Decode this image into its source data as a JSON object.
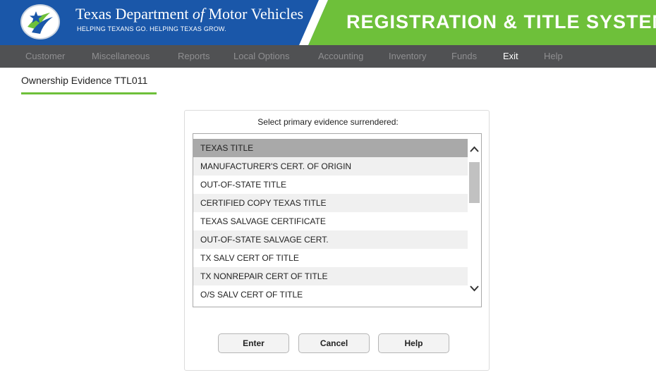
{
  "header": {
    "agency_name_part1": "Texas Department ",
    "agency_name_of": "of",
    "agency_name_part2": " Motor Vehicles",
    "tagline": "HELPING TEXANS GO. HELPING TEXAS GROW.",
    "system_title": "REGISTRATION & TITLE SYSTEM",
    "colors": {
      "blue": "#1a57a9",
      "green": "#6ec03a"
    }
  },
  "nav": {
    "items": [
      {
        "label": "Customer",
        "active": false
      },
      {
        "label": "Miscellaneous",
        "active": false
      },
      {
        "label": "Reports",
        "active": false
      },
      {
        "label": "Local Options",
        "active": false
      },
      {
        "label": "Accounting",
        "active": false
      },
      {
        "label": "Inventory",
        "active": false
      },
      {
        "label": "Funds",
        "active": false
      },
      {
        "label": "Exit",
        "active": true
      },
      {
        "label": "Help",
        "active": false
      }
    ]
  },
  "page": {
    "title": "Ownership Evidence TTL011"
  },
  "dialog": {
    "prompt": "Select primary evidence surrendered:",
    "options": [
      "TEXAS TITLE",
      "MANUFACTURER'S CERT. OF ORIGIN",
      "OUT-OF-STATE TITLE",
      "CERTIFIED COPY TEXAS TITLE",
      "TEXAS SALVAGE CERTIFICATE",
      "OUT-OF-STATE SALVAGE CERT.",
      "TX SALV CERT OF TITLE",
      "TX NONREPAIR CERT OF TITLE",
      "O/S SALV CERT OF TITLE"
    ],
    "selected_option": "TEXAS TITLE",
    "buttons": {
      "enter": "Enter",
      "cancel": "Cancel",
      "help": "Help"
    }
  },
  "icons": {
    "logo": "txdmv-star-logo-icon",
    "scroll_up": "chevron-up-icon",
    "scroll_down": "chevron-down-icon"
  }
}
